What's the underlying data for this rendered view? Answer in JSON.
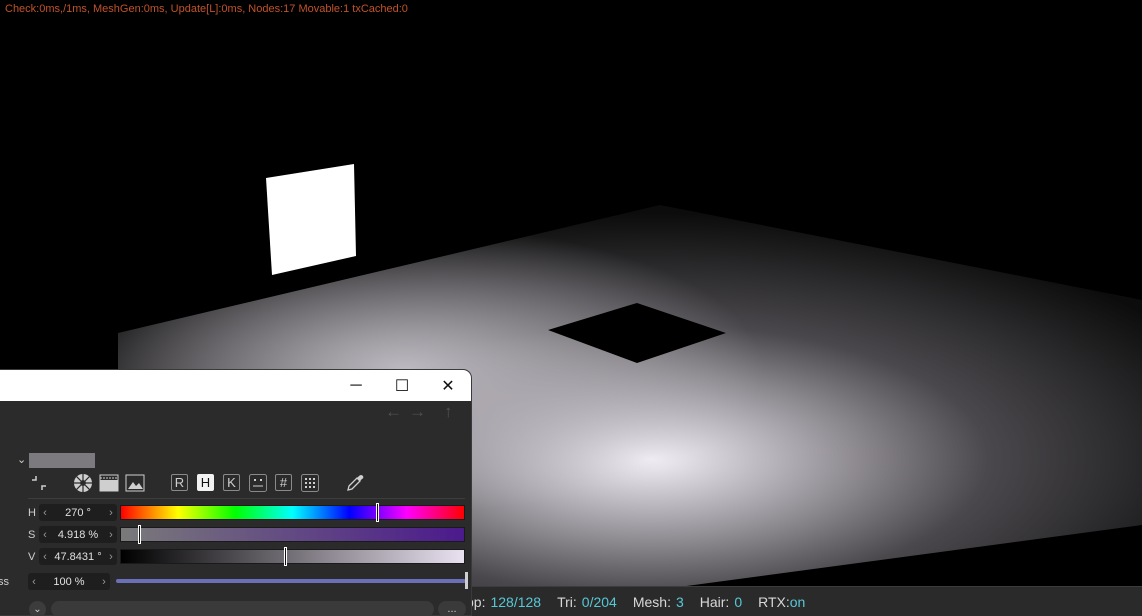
{
  "viewport": {
    "debug_text": "Check:0ms,/1ms, MeshGen:0ms, Update[L]:0ms, Nodes:17 Movable:1 txCached:0"
  },
  "statusbar": {
    "spp_label": "pp:",
    "spp_value": "128/128",
    "tri_label": "Tri:",
    "tri_value": "0/204",
    "mesh_label": "Mesh:",
    "mesh_value": "3",
    "hair_label": "Hair:",
    "hair_value": "0",
    "rtx_label": "RTX:",
    "rtx_value": "on"
  },
  "picker": {
    "titlebar": {
      "minimize": "─",
      "maximize": "☐",
      "close": "✕"
    },
    "nav": {
      "back": "←",
      "forward": "→",
      "up": "↑"
    },
    "swatch_color": "#7c7a7e",
    "modes": [
      "R",
      "H",
      "K"
    ],
    "active_mode": "H",
    "icons": {
      "collapse": "collapse-icon",
      "wheel": "color-wheel-icon",
      "spectrum": "spectrum-icon",
      "image": "image-icon",
      "mix": "mix-icon",
      "hex": "#",
      "swatches": "swatches-icon",
      "eyedropper": "eyedropper-icon"
    },
    "h": {
      "label": "H",
      "value": "270 °",
      "marker": 0.75
    },
    "s": {
      "label": "S",
      "value": "4.918 %",
      "marker": 0.04918
    },
    "v": {
      "label": "V",
      "value": "47.8431 °",
      "marker": 0.478431
    },
    "alpha": {
      "label": "ss",
      "value": "100 %",
      "level": 1.0
    },
    "more_label": "..."
  }
}
